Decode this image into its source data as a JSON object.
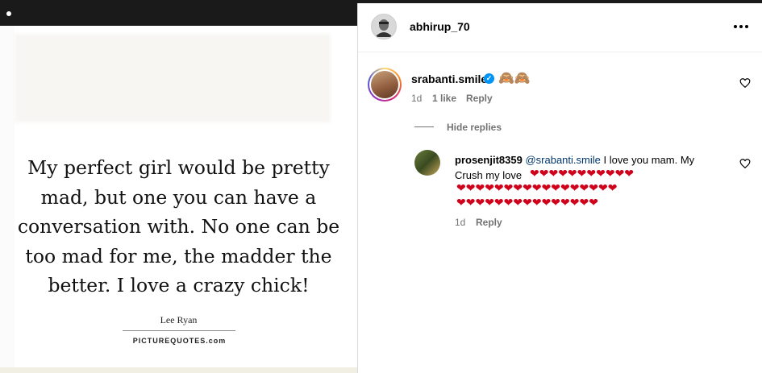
{
  "image": {
    "quote_lines": [
      "My perfect girl would be pretty",
      "mad, but one you can have a",
      "conversation with. No one can be",
      "too mad for me, the madder the",
      "better. I love a crazy chick!"
    ],
    "author": "Lee Ryan",
    "source": "PICTUREQUOTES.com"
  },
  "post_header": {
    "username": "abhirup_70",
    "more_label": "More options"
  },
  "comment": {
    "username": "srabanti.smile",
    "verified": true,
    "text": "🙈🙈",
    "time": "1d",
    "likes": "1 like",
    "reply_label": "Reply"
  },
  "hide_replies_label": "Hide replies",
  "reply": {
    "username": "prosenjit8359",
    "mention": "@srabanti.smile",
    "text_line1": "I love you mam. My",
    "text_line2": "Crush my love",
    "hearts_line1": "❤❤❤❤❤❤❤❤❤❤❤",
    "hearts_line2": "❤❤❤❤❤❤❤❤❤❤❤❤❤❤❤❤❤",
    "hearts_line3": "❤❤❤❤❤❤❤❤❤❤❤❤❤❤❤",
    "time": "1d",
    "reply_label": "Reply"
  },
  "icons": {
    "more": "more-horizontal-icon",
    "heart": "heart-outline-icon",
    "verified": "verified-badge-icon"
  },
  "colors": {
    "link": "#00376b",
    "meta": "#737373",
    "verified": "#0095f6",
    "heart": "#d0021b"
  }
}
